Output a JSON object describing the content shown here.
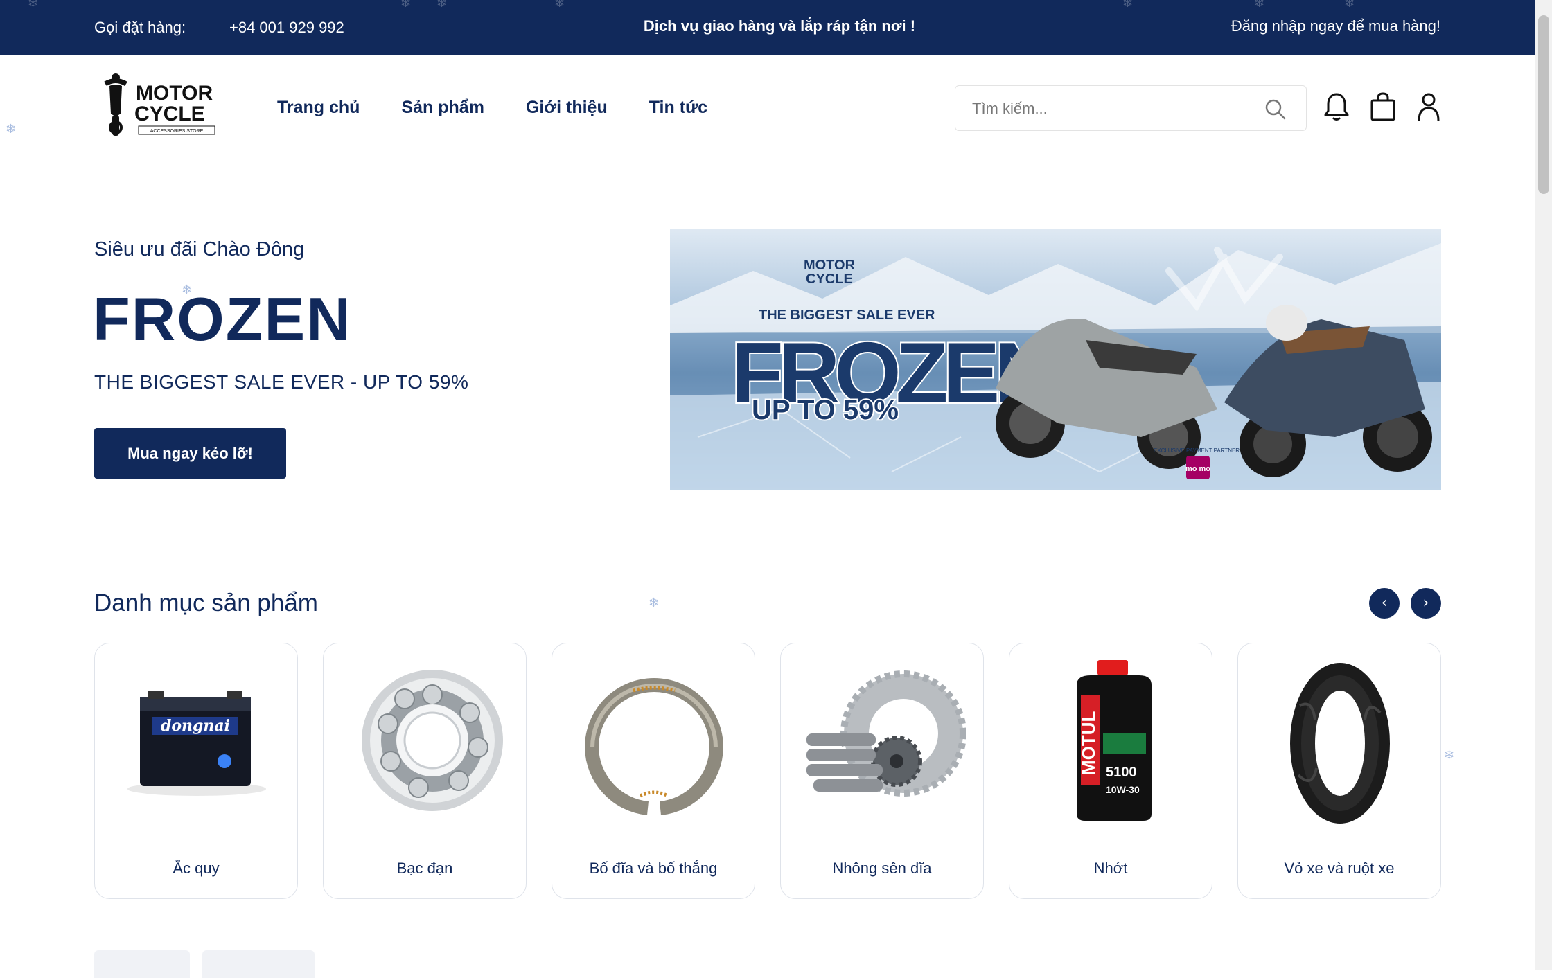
{
  "topbar": {
    "call_label": "Gọi đặt hàng:",
    "phone": "+84 001 929 992",
    "service": "Dịch vụ giao hàng và lắp ráp tận nơi !",
    "login": "Đăng nhập ngay để mua hàng!"
  },
  "logo": {
    "line1": "MOTOR",
    "line2": "CYCLE",
    "tagline": "ACCESSORIES STORE"
  },
  "nav": [
    "Trang chủ",
    "Sản phẩm",
    "Giới thiệu",
    "Tin tức"
  ],
  "search": {
    "placeholder": "Tìm kiếm..."
  },
  "icons": {
    "search": "search-icon",
    "bell": "bell-icon",
    "cart": "bag-icon",
    "user": "user-icon"
  },
  "hero": {
    "subtitle": "Siêu ưu đãi Chào Đông",
    "title": "FROZEN",
    "tagline": "THE BIGGEST SALE EVER - UP TO 59%",
    "button": "Mua ngay kẻo lỡ!",
    "banner": {
      "logo1": "MOTOR",
      "logo2": "CYCLE",
      "headline": "THE BIGGEST SALE EVER",
      "big": "FROZEN",
      "discount": "UP TO 59%",
      "partner": "EXCLUSIVE PAYMENT PARTNER",
      "partner_logo": "mo mo"
    }
  },
  "categories": {
    "heading": "Danh mục sản phẩm",
    "prev": "‹",
    "next": "›",
    "items": [
      {
        "label": "Ắc quy",
        "brand": "dongnai"
      },
      {
        "label": "Bạc đạn"
      },
      {
        "label": "Bố đĩa và bố thắng"
      },
      {
        "label": "Nhông sên dĩa"
      },
      {
        "label": "Nhớt",
        "brand": "MOTUL",
        "grade": "5100",
        "visc": "10W-30"
      },
      {
        "label": "Vỏ xe và ruột xe"
      }
    ]
  },
  "colors": {
    "navy": "#11295b",
    "white": "#ffffff",
    "border": "#dfe3ea"
  }
}
